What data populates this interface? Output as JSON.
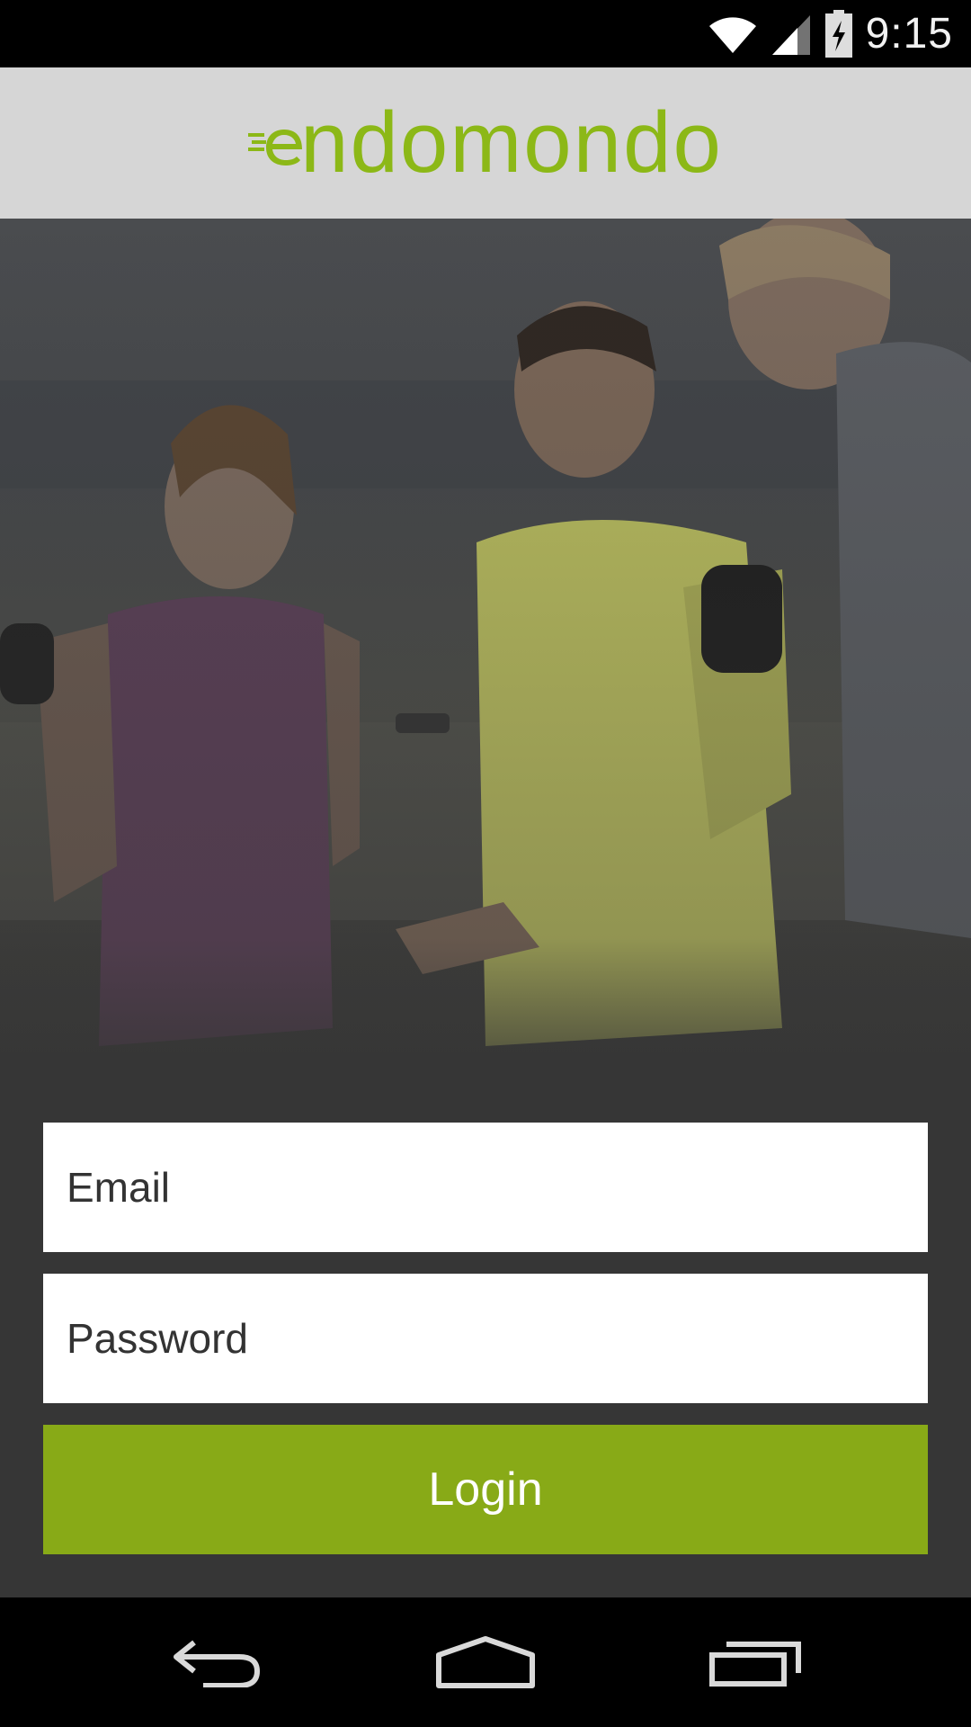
{
  "status_bar": {
    "time": "9:15",
    "icons": [
      "wifi-icon",
      "cell-signal-icon",
      "battery-charging-icon"
    ]
  },
  "header": {
    "logo_text": "ndomondo",
    "brand_color": "#8cb817"
  },
  "hero": {
    "image": "photo of three people in sportswear, a man in a yellow shirt holding a phone"
  },
  "login_form": {
    "email_placeholder": "Email",
    "password_placeholder": "Password",
    "login_label": "Login",
    "button_color": "#88aa17"
  },
  "nav_bar": {
    "icons": [
      "back-icon",
      "home-icon",
      "recents-icon"
    ]
  }
}
